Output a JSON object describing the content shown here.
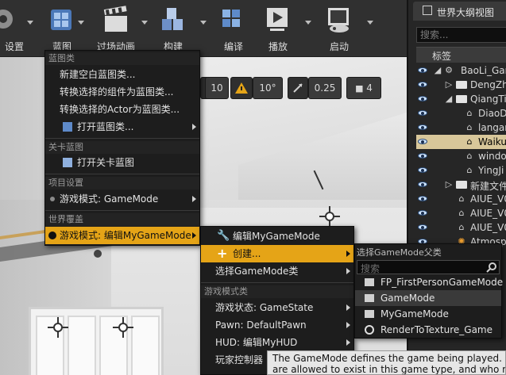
{
  "toolbar": {
    "settings": "设置",
    "blueprints": "蓝图",
    "cinematics": "过场动画",
    "build": "构建",
    "compile": "编译",
    "play": "播放",
    "launch": "启动"
  },
  "viewport_tools": {
    "grid_snap": "10",
    "rotation_snap": "10°",
    "scale_snap": "0.25",
    "camera_speed": "4"
  },
  "outliner": {
    "tab_title": "世界大纲视图",
    "search_placeholder": "搜索...",
    "column_label": "标签",
    "rows": [
      {
        "label": "BaoLi_Gam"
      },
      {
        "label": "DengZha"
      },
      {
        "label": "QiangTi"
      },
      {
        "label": "DiaoD"
      },
      {
        "label": "langar"
      },
      {
        "label": "Waiku"
      },
      {
        "label": "windo"
      },
      {
        "label": "YingJi"
      },
      {
        "label": "新建文件"
      },
      {
        "label": "AIUE_V0"
      },
      {
        "label": "AIUE_V0"
      },
      {
        "label": "AIUE_V0"
      },
      {
        "label": "Atmosph"
      }
    ]
  },
  "blueprints_menu": {
    "section_blueprint_class": "蓝图类",
    "new_empty_blueprint": "新建空白蓝图类...",
    "convert_components": "转换选择的组件为蓝图类...",
    "convert_actor": "转换选择的Actor为蓝图类...",
    "open_blueprint_class": "打开蓝图类...",
    "section_level_blueprint": "关卡蓝图",
    "open_level_blueprint": "打开关卡蓝图",
    "section_project_settings": "项目设置",
    "game_mode_project": "游戏模式: GameMode",
    "section_world_override": "世界覆盖",
    "game_mode_world": "游戏模式: 编辑MyGameMode"
  },
  "gamemode_menu": {
    "edit_gamemode": "编辑MyGameMode",
    "create": "创建...",
    "select_class": "选择GameMode类",
    "section_gamemode_classes": "游戏模式类",
    "game_state": "游戏状态: GameState",
    "pawn": "Pawn: DefaultPawn",
    "hud": "HUD: 编辑MyHUD",
    "player_controller": "玩家控制器"
  },
  "parent_picker": {
    "title": "选择GameMode父类",
    "search_placeholder": "搜索",
    "items": [
      {
        "label": "FP_FirstPersonGameMode"
      },
      {
        "label": "GameMode"
      },
      {
        "label": "MyGameMode"
      },
      {
        "label": "RenderToTexture_Game"
      }
    ]
  },
  "tooltip": {
    "line1": "The GameMode defines the game being played. It gove",
    "line2": "are allowed to exist in this game type, and who may en"
  },
  "colors": {
    "highlight": "#e5a417",
    "menu_bg": "#1d1d1d",
    "outliner_selected": "#d8c79a"
  }
}
